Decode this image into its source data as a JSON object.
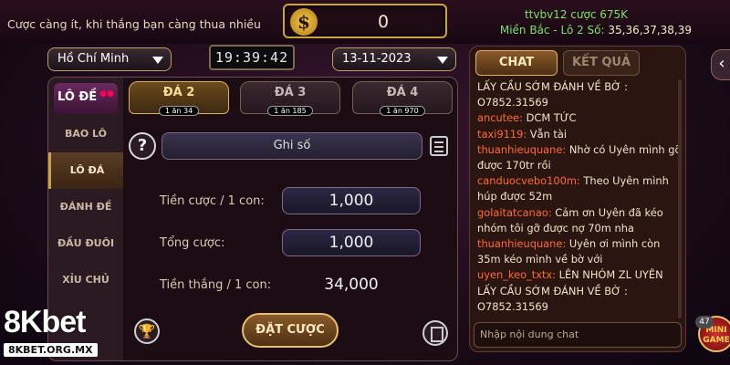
{
  "header": {
    "slogan": "Cược càng ít, khi thắng bạn càng thua nhiều",
    "balance": "0",
    "user_line": "ttvbv12 cược 675K",
    "results_prefix": "Miền Bắc - Lô 2 Số:",
    "results_numbers": "35,36,37,38,39"
  },
  "selectors": {
    "region": "Hồ Chí Minh",
    "time": "19:39:42",
    "date": "13-11-2023"
  },
  "side_menu": {
    "logo": "LÔ ĐỀ",
    "items": [
      "BAO LÔ",
      "LÔ ĐÁ",
      "ĐÁNH ĐỀ",
      "ĐẦU ĐUÔI",
      "XỈU CHỦ"
    ],
    "active_index": 1
  },
  "tabs": [
    {
      "label": "ĐÁ 2",
      "sub": "1 ăn 34"
    },
    {
      "label": "ĐÁ 3",
      "sub": "1 ăn 185"
    },
    {
      "label": "ĐÁ 4",
      "sub": "1 ăn 970"
    }
  ],
  "form": {
    "ghi_so": "Ghi số",
    "stake_label": "Tiền cược / 1 con:",
    "stake_value": "1,000",
    "total_label": "Tổng cược:",
    "total_value": "1,000",
    "win_label": "Tiền thắng / 1 con:",
    "win_value": "34,000",
    "bet_button": "ĐẶT CƯỢC"
  },
  "chat": {
    "tab_chat": "CHAT",
    "tab_results": "KẾT QUẢ",
    "messages": [
      {
        "user": "",
        "text": "LẤY CẦU SỚM ĐÁNH VỀ BỜ :"
      },
      {
        "user": "",
        "text": "O7852.31569"
      },
      {
        "user": "ancutee:",
        "text": " DCM TỨC"
      },
      {
        "user": "taxi9119:",
        "text": " Vẫn tài"
      },
      {
        "user": "thuanhieuquane:",
        "text": " Nhờ có Uyên mình gỡ được 170tr rồi"
      },
      {
        "user": "canduocvebo100m:",
        "text": " Theo Uyên mình húp được 52m"
      },
      {
        "user": "golaitatcanao:",
        "text": " Cảm ơn Uyên đã kéo nhóm tôi gỡ được nợ 70m nha"
      },
      {
        "user": "thuanhieuquane:",
        "text": " Uyên ơi mình còn 35m kéo mình về bờ với"
      },
      {
        "user": "uyen_keo_txtx:",
        "text": " LÊN NHÓM ZL UYÊN LẤY CẦU SỚM ĐÁNH VỀ BỜ : O7852.31569"
      }
    ],
    "input_placeholder": "Nhập nội dung chat"
  },
  "mini_game": {
    "badge": "47",
    "label": "MINI GAME"
  },
  "brand": {
    "logo": "8Kbet",
    "url": "8KBET.ORG.MX"
  },
  "icons": {
    "dollar": "dollar-icon",
    "help": "question-icon",
    "note": "edit-note-icon",
    "trophy": "trophy-icon",
    "receipt": "receipt-icon"
  }
}
